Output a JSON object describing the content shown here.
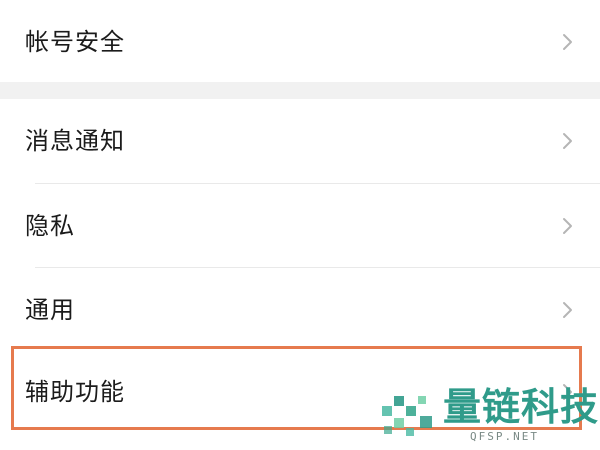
{
  "settings": {
    "account_security": "帐号安全",
    "items": [
      {
        "label": "消息通知"
      },
      {
        "label": "隐私"
      },
      {
        "label": "通用"
      },
      {
        "label": "辅助功能"
      }
    ]
  },
  "icons": {
    "chevron": "chevron-right-icon"
  },
  "colors": {
    "highlight_border": "#e67a4e",
    "watermark_text": "#2f9b8a",
    "page_background": "#f1f1f1",
    "row_background": "#ffffff"
  },
  "watermark": {
    "title": "量链科技",
    "subtitle": "QFSP.NET"
  }
}
